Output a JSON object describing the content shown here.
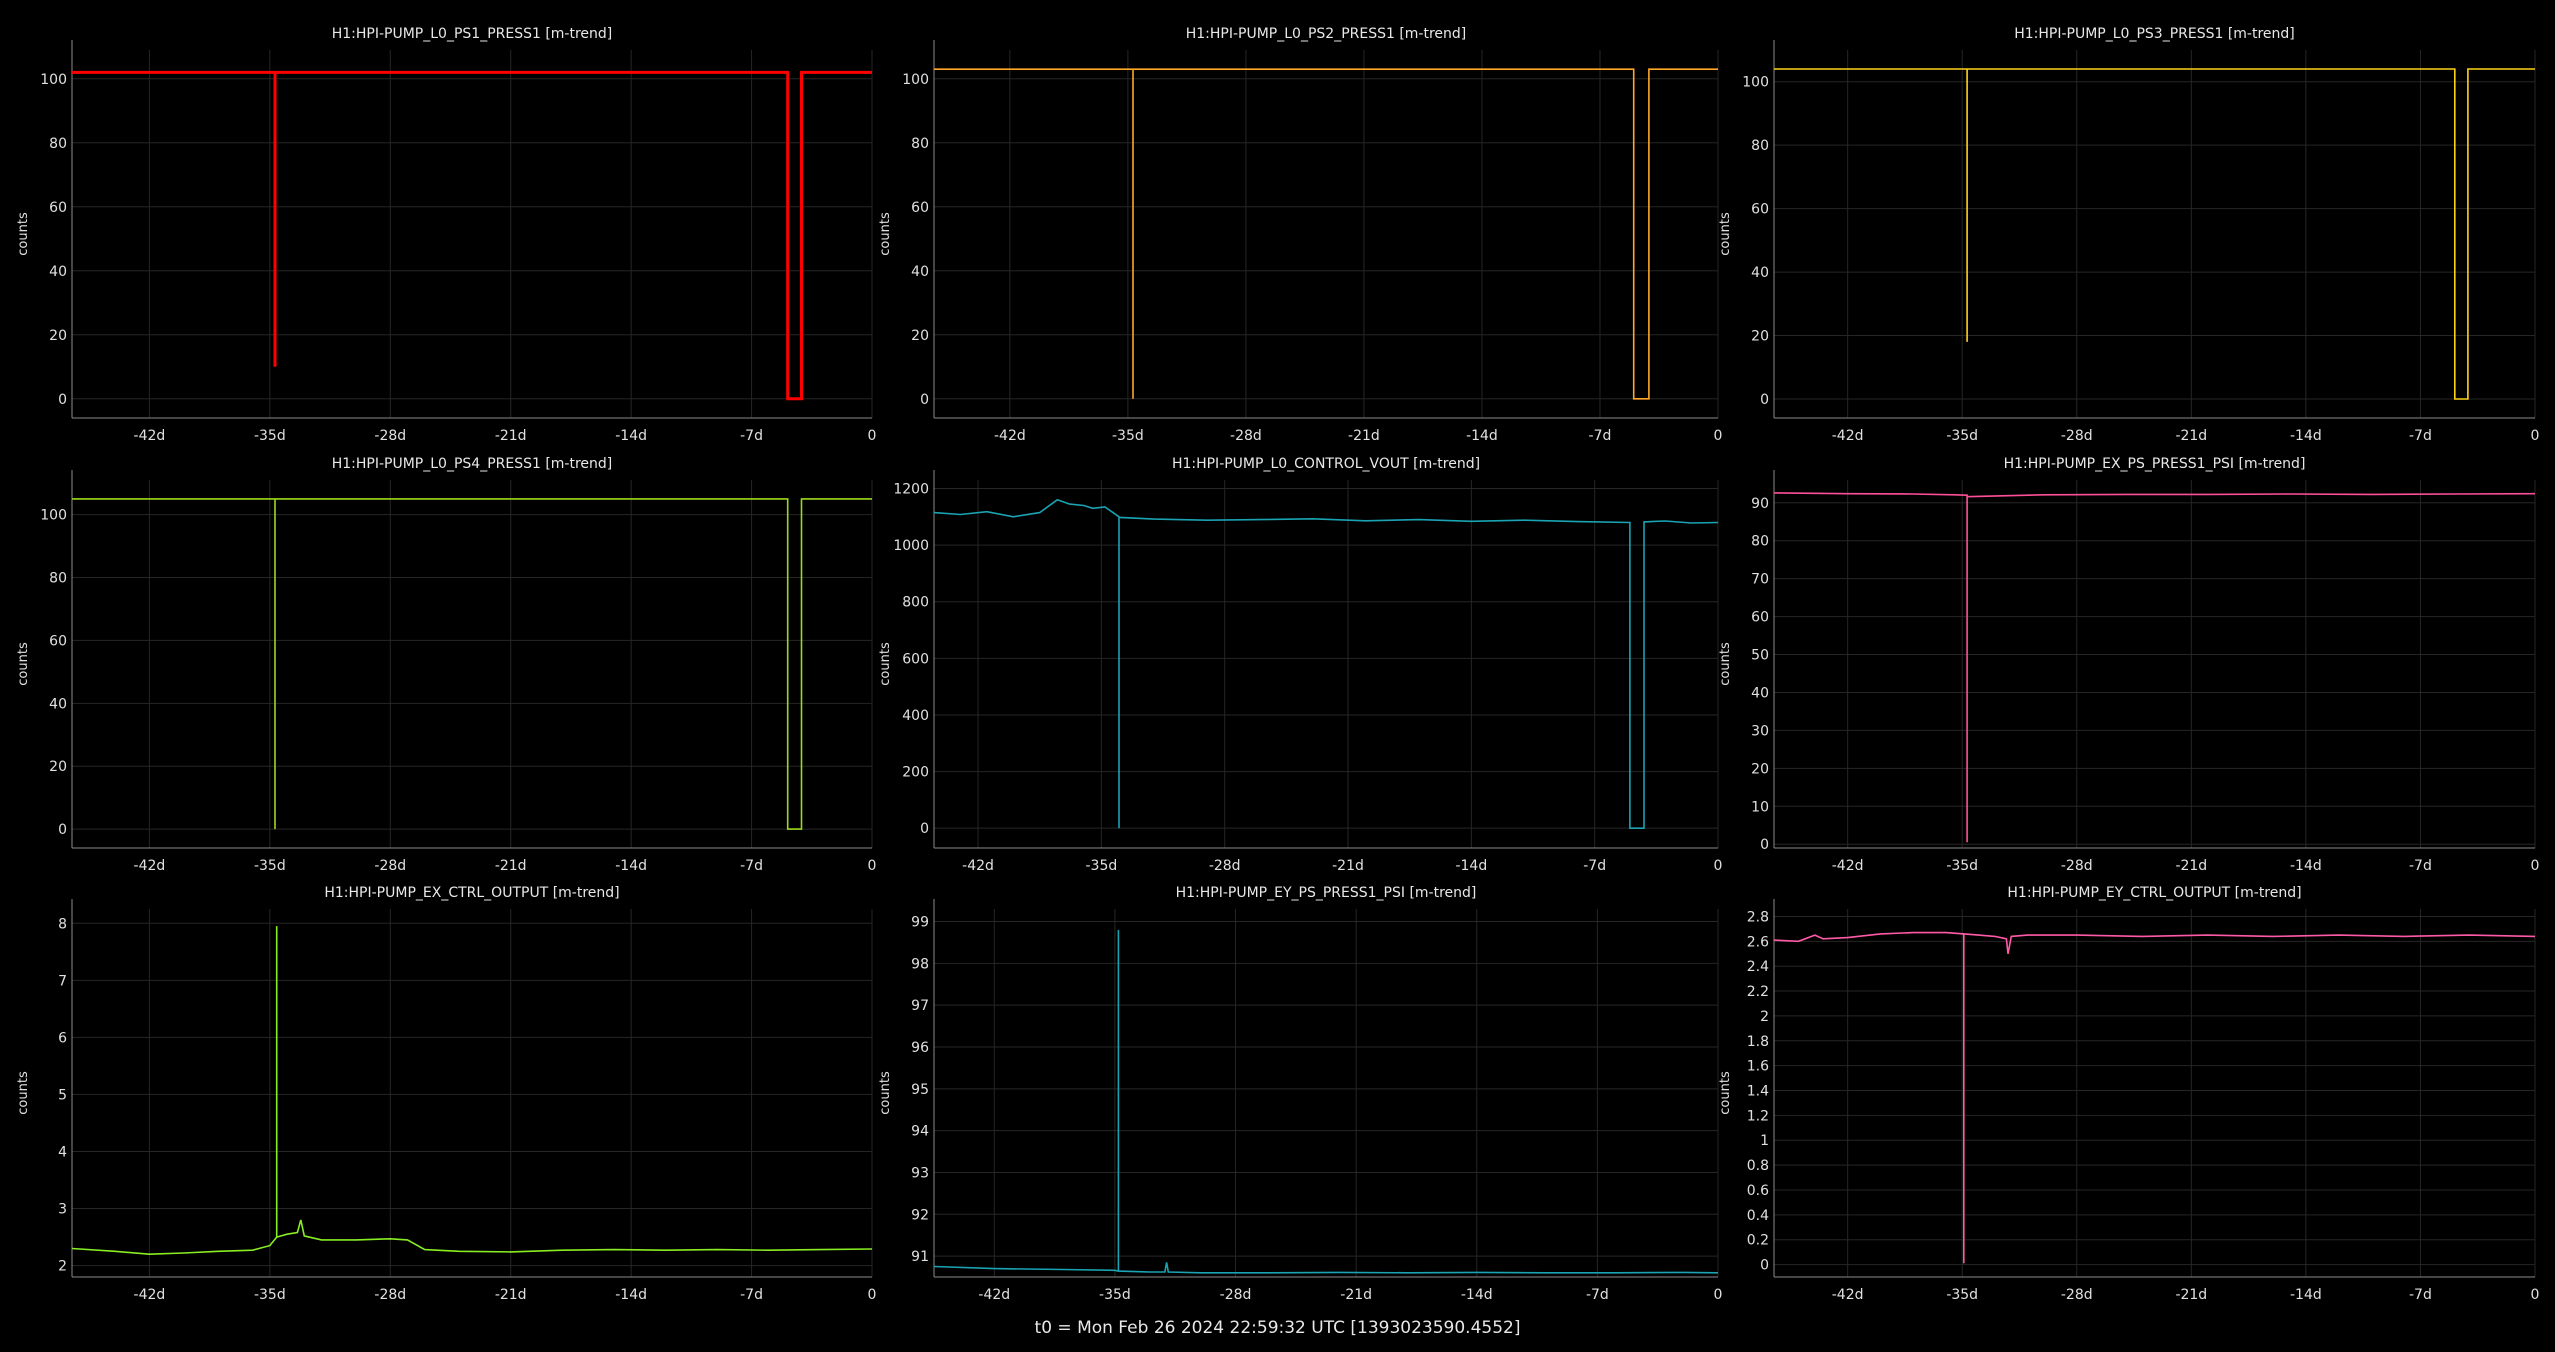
{
  "footer": {
    "t0_label": "t0 = Mon Feb 26 2024 22:59:32 UTC [1393023590.4552]"
  },
  "chart_data": [
    {
      "type": "line",
      "title": "H1:HPI-PUMP_L0_PS1_PRESS1 [m-trend]",
      "ylabel": "counts",
      "color": "#ff0000",
      "xlim": [
        -46.5,
        0
      ],
      "ylim": [
        -6,
        109
      ],
      "xticks": [
        -42,
        -35,
        -28,
        -21,
        -14,
        -7,
        0
      ],
      "xticklabels": [
        "-42d",
        "-35d",
        "-28d",
        "-21d",
        "-14d",
        "-7d",
        "0"
      ],
      "yticks": [
        0,
        20,
        40,
        60,
        80,
        100
      ],
      "yticklabels": [
        "0",
        "20",
        "40",
        "60",
        "80",
        "100"
      ],
      "series": [
        {
          "x": [
            -46.5,
            -34.7,
            -34.7,
            -34.7,
            -34.7,
            -4.9,
            -4.9,
            -4.1,
            -4.1,
            0
          ],
          "y": [
            102,
            102,
            10,
            10,
            102,
            102,
            0,
            0,
            102,
            102
          ]
        }
      ]
    },
    {
      "type": "line",
      "title": "H1:HPI-PUMP_L0_PS2_PRESS1 [m-trend]",
      "ylabel": "counts",
      "color": "#ffa726",
      "xlim": [
        -46.5,
        0
      ],
      "ylim": [
        -6,
        109
      ],
      "xticks": [
        -42,
        -35,
        -28,
        -21,
        -14,
        -7,
        0
      ],
      "xticklabels": [
        "-42d",
        "-35d",
        "-28d",
        "-21d",
        "-14d",
        "-7d",
        "0"
      ],
      "yticks": [
        0,
        20,
        40,
        60,
        80,
        100
      ],
      "yticklabels": [
        "0",
        "20",
        "40",
        "60",
        "80",
        "100"
      ],
      "series": [
        {
          "x": [
            -46.5,
            -34.7,
            -34.7,
            -34.7,
            -5.0,
            -5.0,
            -4.1,
            -4.1,
            0
          ],
          "y": [
            103,
            103,
            0,
            103,
            103,
            0,
            0,
            103,
            103
          ]
        }
      ]
    },
    {
      "type": "line",
      "title": "H1:HPI-PUMP_L0_PS3_PRESS1 [m-trend]",
      "ylabel": "counts",
      "color": "#ffd21a",
      "xlim": [
        -46.5,
        0
      ],
      "ylim": [
        -6,
        110
      ],
      "xticks": [
        -42,
        -35,
        -28,
        -21,
        -14,
        -7,
        0
      ],
      "xticklabels": [
        "-42d",
        "-35d",
        "-28d",
        "-21d",
        "-14d",
        "-7d",
        "0"
      ],
      "yticks": [
        0,
        20,
        40,
        60,
        80,
        100
      ],
      "yticklabels": [
        "0",
        "20",
        "40",
        "60",
        "80",
        "100"
      ],
      "series": [
        {
          "x": [
            -46.5,
            -34.7,
            -34.7,
            -34.7,
            -4.9,
            -4.9,
            -4.1,
            -4.1,
            0
          ],
          "y": [
            104,
            104,
            18,
            104,
            104,
            0,
            0,
            104,
            104
          ]
        }
      ]
    },
    {
      "type": "line",
      "title": "H1:HPI-PUMP_L0_PS4_PRESS1 [m-trend]",
      "ylabel": "counts",
      "color": "#9bd91b",
      "xlim": [
        -46.5,
        0
      ],
      "ylim": [
        -6,
        111
      ],
      "xticks": [
        -42,
        -35,
        -28,
        -21,
        -14,
        -7,
        0
      ],
      "xticklabels": [
        "-42d",
        "-35d",
        "-28d",
        "-21d",
        "-14d",
        "-7d",
        "0"
      ],
      "yticks": [
        0,
        20,
        40,
        60,
        80,
        100
      ],
      "yticklabels": [
        "0",
        "20",
        "40",
        "60",
        "80",
        "100"
      ],
      "series": [
        {
          "x": [
            -46.5,
            -34.7,
            -34.7,
            -34.7,
            -4.9,
            -4.9,
            -4.1,
            -4.1,
            0
          ],
          "y": [
            105,
            105,
            0,
            105,
            105,
            0,
            0,
            105,
            105
          ]
        }
      ]
    },
    {
      "type": "line",
      "title": "H1:HPI-PUMP_L0_CONTROL_VOUT [m-trend]",
      "ylabel": "counts",
      "color": "#1aa3b3",
      "xlim": [
        -44.5,
        0
      ],
      "ylim": [
        -70,
        1230
      ],
      "xticks": [
        -42,
        -35,
        -28,
        -21,
        -14,
        -7,
        0
      ],
      "xticklabels": [
        "-42d",
        "-35d",
        "-28d",
        "-21d",
        "-14d",
        "-7d",
        "0"
      ],
      "yticks": [
        0,
        200,
        400,
        600,
        800,
        1000,
        1200
      ],
      "yticklabels": [
        "0",
        "200",
        "400",
        "600",
        "800",
        "1000",
        "1200"
      ],
      "series": [
        {
          "x": [
            -44.5,
            -43,
            -41.5,
            -40,
            -38.5,
            -37.5,
            -36.8,
            -36,
            -35.5,
            -34.8,
            -34.0,
            -34.0,
            -34.0,
            -32,
            -29,
            -26,
            -23,
            -20,
            -17,
            -14,
            -11,
            -8,
            -5.0,
            -5.0,
            -4.2,
            -4.2,
            -3,
            -1.5,
            0
          ],
          "y": [
            1115,
            1108,
            1118,
            1100,
            1115,
            1160,
            1145,
            1140,
            1130,
            1135,
            1100,
            0,
            1098,
            1092,
            1088,
            1090,
            1093,
            1086,
            1090,
            1084,
            1088,
            1083,
            1080,
            0,
            0,
            1082,
            1085,
            1078,
            1080
          ]
        }
      ]
    },
    {
      "type": "line",
      "title": "H1:HPI-PUMP_EX_PS_PRESS1_PSI [m-trend]",
      "ylabel": "counts",
      "color": "#ff4f9a",
      "xlim": [
        -46.5,
        0
      ],
      "ylim": [
        -1,
        96
      ],
      "xticks": [
        -42,
        -35,
        -28,
        -21,
        -14,
        -7,
        0
      ],
      "xticklabels": [
        "-42d",
        "-35d",
        "-28d",
        "-21d",
        "-14d",
        "-7d",
        "0"
      ],
      "yticks": [
        0,
        10,
        20,
        30,
        40,
        50,
        60,
        70,
        80,
        90
      ],
      "yticklabels": [
        "0",
        "10",
        "20",
        "30",
        "40",
        "50",
        "60",
        "70",
        "80",
        "90"
      ],
      "series": [
        {
          "x": [
            -46.5,
            -42,
            -38,
            -35.5,
            -34.7,
            -34.7,
            -34.7,
            -30,
            -25,
            -20,
            -15,
            -10,
            -5,
            0
          ],
          "y": [
            92.6,
            92.4,
            92.3,
            92.1,
            92.0,
            0.5,
            91.6,
            92.1,
            92.2,
            92.2,
            92.3,
            92.2,
            92.3,
            92.4
          ]
        }
      ]
    },
    {
      "type": "line",
      "title": "H1:HPI-PUMP_EX_CTRL_OUTPUT [m-trend]",
      "ylabel": "counts",
      "color": "#88ee22",
      "xlim": [
        -46.5,
        0
      ],
      "ylim": [
        1.8,
        8.25
      ],
      "xticks": [
        -42,
        -35,
        -28,
        -21,
        -14,
        -7,
        0
      ],
      "xticklabels": [
        "-42d",
        "-35d",
        "-28d",
        "-21d",
        "-14d",
        "-7d",
        "0"
      ],
      "yticks": [
        2,
        3,
        4,
        5,
        6,
        7,
        8
      ],
      "yticklabels": [
        "2",
        "3",
        "4",
        "5",
        "6",
        "7",
        "8"
      ],
      "series": [
        {
          "x": [
            -46.5,
            -44,
            -42,
            -40,
            -38,
            -36,
            -35,
            -34.6,
            -34.6,
            -34.6,
            -34,
            -33.4,
            -33.2,
            -33.0,
            -32,
            -30,
            -28,
            -27,
            -26,
            -24,
            -21,
            -18,
            -15,
            -12,
            -9,
            -6,
            -3,
            0
          ],
          "y": [
            2.3,
            2.25,
            2.2,
            2.22,
            2.25,
            2.27,
            2.35,
            2.5,
            7.95,
            2.5,
            2.55,
            2.58,
            2.8,
            2.52,
            2.45,
            2.45,
            2.47,
            2.45,
            2.28,
            2.25,
            2.24,
            2.27,
            2.28,
            2.27,
            2.28,
            2.27,
            2.28,
            2.29
          ]
        }
      ]
    },
    {
      "type": "line",
      "title": "H1:HPI-PUMP_EY_PS_PRESS1_PSI [m-trend]",
      "ylabel": "counts",
      "color": "#1aa3b3",
      "xlim": [
        -45.5,
        0
      ],
      "ylim": [
        90.5,
        99.3
      ],
      "xticks": [
        -42,
        -35,
        -28,
        -21,
        -14,
        -7,
        0
      ],
      "xticklabels": [
        "-42d",
        "-35d",
        "-28d",
        "-21d",
        "-14d",
        "-7d",
        "0"
      ],
      "yticks": [
        91,
        92,
        93,
        94,
        95,
        96,
        97,
        98,
        99
      ],
      "yticklabels": [
        "91",
        "92",
        "93",
        "94",
        "95",
        "96",
        "97",
        "98",
        "99"
      ],
      "series": [
        {
          "x": [
            -45.5,
            -42,
            -38,
            -35,
            -34.8,
            -34.8,
            -34.8,
            -33,
            -32.1,
            -32.0,
            -31.9,
            -30,
            -26,
            -22,
            -18,
            -14,
            -10,
            -6,
            -2,
            0
          ],
          "y": [
            90.75,
            90.7,
            90.68,
            90.66,
            90.64,
            98.8,
            90.64,
            90.62,
            90.62,
            90.85,
            90.62,
            90.6,
            90.6,
            90.61,
            90.6,
            90.61,
            90.6,
            90.6,
            90.61,
            90.6
          ]
        }
      ]
    },
    {
      "type": "line",
      "title": "H1:HPI-PUMP_EY_CTRL_OUTPUT [m-trend]",
      "ylabel": "counts",
      "color": "#ff5aa8",
      "xlim": [
        -46.5,
        0
      ],
      "ylim": [
        -0.1,
        2.86
      ],
      "xticks": [
        -42,
        -35,
        -28,
        -21,
        -14,
        -7,
        0
      ],
      "xticklabels": [
        "-42d",
        "-35d",
        "-28d",
        "-21d",
        "-14d",
        "-7d",
        "0"
      ],
      "yticks": [
        0,
        0.2,
        0.4,
        0.6,
        0.8,
        1,
        1.2,
        1.4,
        1.6,
        1.8,
        2,
        2.2,
        2.4,
        2.6,
        2.8
      ],
      "yticklabels": [
        "0",
        "0.2",
        "0.4",
        "0.6",
        "0.8",
        "1",
        "1.2",
        "1.4",
        "1.6",
        "1.8",
        "2",
        "2.2",
        "2.4",
        "2.6",
        "2.8"
      ],
      "series": [
        {
          "x": [
            -46.5,
            -45,
            -44,
            -43.5,
            -42,
            -40,
            -38,
            -36,
            -34.9,
            -34.9,
            -34.9,
            -34,
            -33,
            -32.3,
            -32.2,
            -32.0,
            -31,
            -28,
            -24,
            -20,
            -16,
            -12,
            -8,
            -4,
            0
          ],
          "y": [
            2.61,
            2.6,
            2.65,
            2.62,
            2.63,
            2.66,
            2.67,
            2.67,
            2.66,
            0.01,
            2.66,
            2.65,
            2.64,
            2.62,
            2.5,
            2.64,
            2.65,
            2.65,
            2.64,
            2.65,
            2.64,
            2.65,
            2.64,
            2.65,
            2.64
          ]
        }
      ]
    }
  ]
}
